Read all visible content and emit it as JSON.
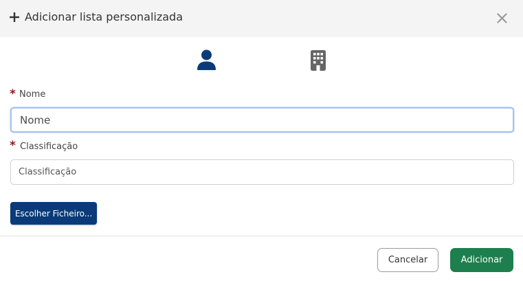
{
  "dialog": {
    "title": "Adicionar lista personalizada",
    "icons": {
      "title": "plus-icon",
      "close": "close-icon"
    }
  },
  "tabs": [
    {
      "icon": "person-icon",
      "color": "#0a3b78",
      "selected": true
    },
    {
      "icon": "building-icon",
      "color": "#666666",
      "selected": false
    }
  ],
  "form": {
    "required_marker": "*",
    "nome": {
      "label": "Nome",
      "placeholder": "Nome",
      "value": ""
    },
    "classificacao": {
      "label": "Classificação",
      "placeholder": "Classificação",
      "value": ""
    },
    "file_button_label": "Escolher Ficheiro..."
  },
  "footer": {
    "cancel_label": "Cancelar",
    "add_label": "Adicionar"
  },
  "colors": {
    "primary": "#0a3b78",
    "success": "#1d7f4e",
    "required": "#8b1c2b",
    "header_bg": "#f4f4f5"
  }
}
